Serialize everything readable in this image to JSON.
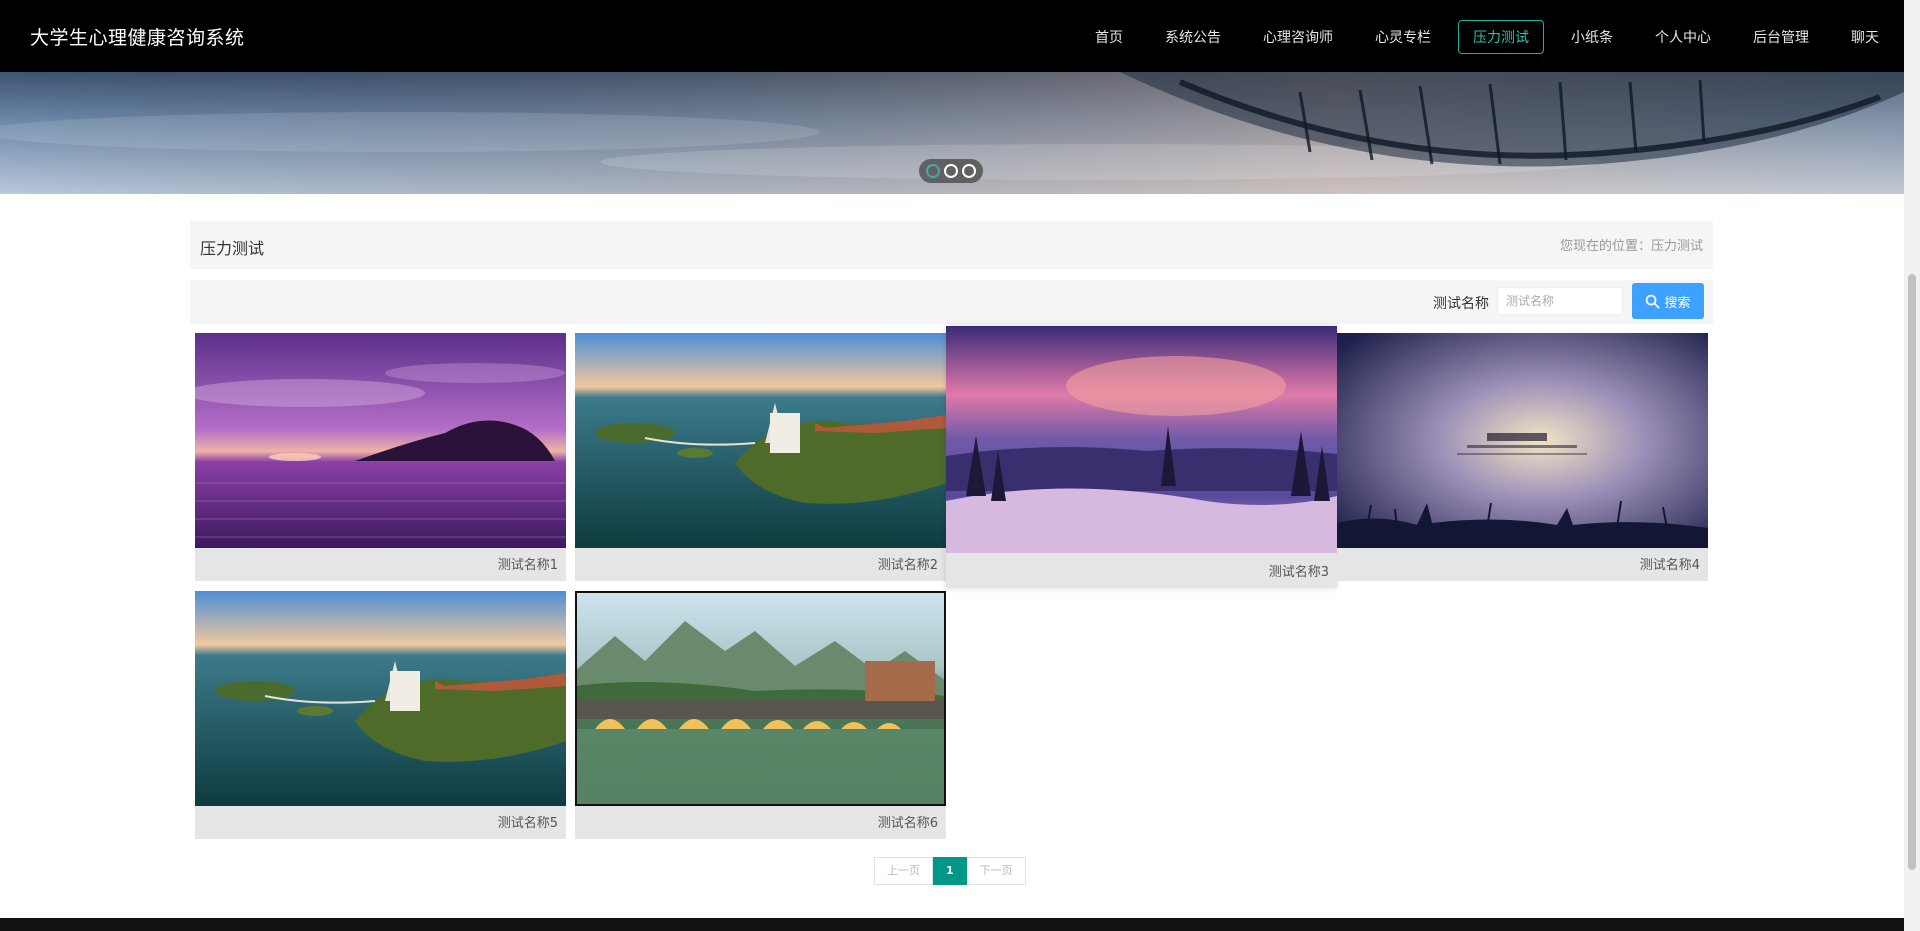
{
  "header": {
    "brand": "大学生心理健康咨询系统",
    "nav": [
      {
        "label": "首页",
        "active": false
      },
      {
        "label": "系统公告",
        "active": false
      },
      {
        "label": "心理咨询师",
        "active": false
      },
      {
        "label": "心灵专栏",
        "active": false
      },
      {
        "label": "压力测试",
        "active": true
      },
      {
        "label": "小纸条",
        "active": false
      },
      {
        "label": "个人中心",
        "active": false
      },
      {
        "label": "后台管理",
        "active": false
      },
      {
        "label": "聊天",
        "active": false
      }
    ]
  },
  "banner": {
    "slides": 3,
    "current": 1
  },
  "section": {
    "title": "压力测试",
    "breadcrumb": "您现在的位置：压力测试"
  },
  "search": {
    "label": "测试名称",
    "placeholder": "测试名称",
    "button": "搜索"
  },
  "cards": [
    {
      "name": "测试名称1",
      "scene": "purple-sunset-sea"
    },
    {
      "name": "测试名称2",
      "scene": "lake-castle-aerial"
    },
    {
      "name": "测试名称3",
      "scene": "mountain-lake-dusk"
    },
    {
      "name": "测试名称4",
      "scene": "starry-night-quote"
    },
    {
      "name": "测试名称5",
      "scene": "lake-castle-aerial"
    },
    {
      "name": "测试名称6",
      "scene": "stone-bridge-river"
    }
  ],
  "pagination": {
    "prev": "上一页",
    "current": "1",
    "next": "下一页"
  },
  "colors": {
    "accent": "#19b3a6",
    "search_button": "#3ea0ff",
    "page_active": "#009688"
  }
}
